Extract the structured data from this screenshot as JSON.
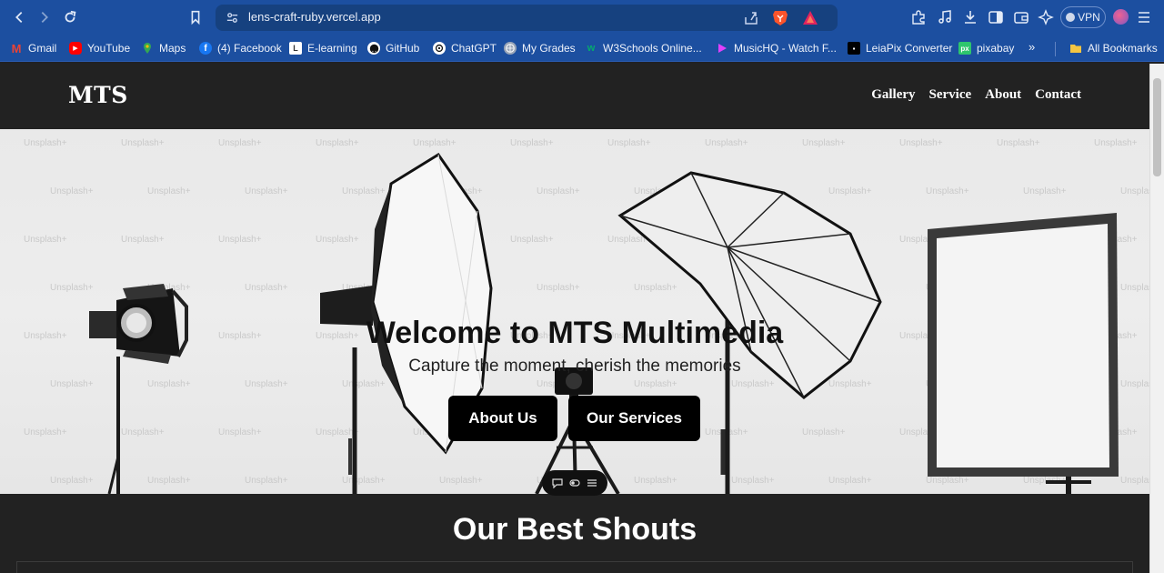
{
  "browser": {
    "url": "lens-craft-ruby.vercel.app",
    "vpn_label": "VPN",
    "nav_icons": [
      "back-icon",
      "forward-icon",
      "reload-icon",
      "bookmark-icon"
    ],
    "extension_icons": [
      "puzzle-icon",
      "music-icon",
      "download-icon",
      "sidebar-icon",
      "wallet-icon",
      "leo-icon"
    ],
    "bookmarks": [
      {
        "label": "Gmail",
        "icon": "gmail-icon",
        "color": "#ea4335"
      },
      {
        "label": "YouTube",
        "icon": "youtube-icon",
        "color": "#ff0000"
      },
      {
        "label": "Maps",
        "icon": "maps-icon",
        "color": "#34a853"
      },
      {
        "label": "(4) Facebook",
        "icon": "facebook-icon",
        "color": "#1877f2"
      },
      {
        "label": "E-learning",
        "icon": "elearning-icon",
        "color": "#ffffff"
      },
      {
        "label": "GitHub",
        "icon": "github-icon",
        "color": "#ffffff"
      },
      {
        "label": "ChatGPT",
        "icon": "chatgpt-icon",
        "color": "#ffffff"
      },
      {
        "label": "My Grades",
        "icon": "grades-icon",
        "color": "#9aa6b8"
      },
      {
        "label": "W3Schools Online...",
        "icon": "w3schools-icon",
        "color": "#04aa6d"
      },
      {
        "label": "MusicHQ - Watch F...",
        "icon": "musichq-icon",
        "color": "#e040fb"
      },
      {
        "label": "LeiaPix Converter",
        "icon": "leiapix-icon",
        "color": "#000000"
      },
      {
        "label": "pixabay",
        "icon": "pixabay-icon",
        "color": "#2ec66d"
      }
    ],
    "bookmarks_more": "»",
    "all_bookmarks": "All Bookmarks"
  },
  "site": {
    "logo": "MTS",
    "nav": [
      "Gallery",
      "Service",
      "About",
      "Contact"
    ],
    "hero": {
      "title": "Welcome to MTS Multimedia",
      "subtitle": "Capture the moment, cherish the memories",
      "button_about": "About Us",
      "button_services": "Our Services",
      "watermark": "Unsplash+"
    },
    "section_title": "Our Best Shouts"
  },
  "colors": {
    "browser_blue": "#1c4fa0",
    "nav_bg": "#222222",
    "hero_bg": "#ececec",
    "button_bg": "#000000"
  }
}
